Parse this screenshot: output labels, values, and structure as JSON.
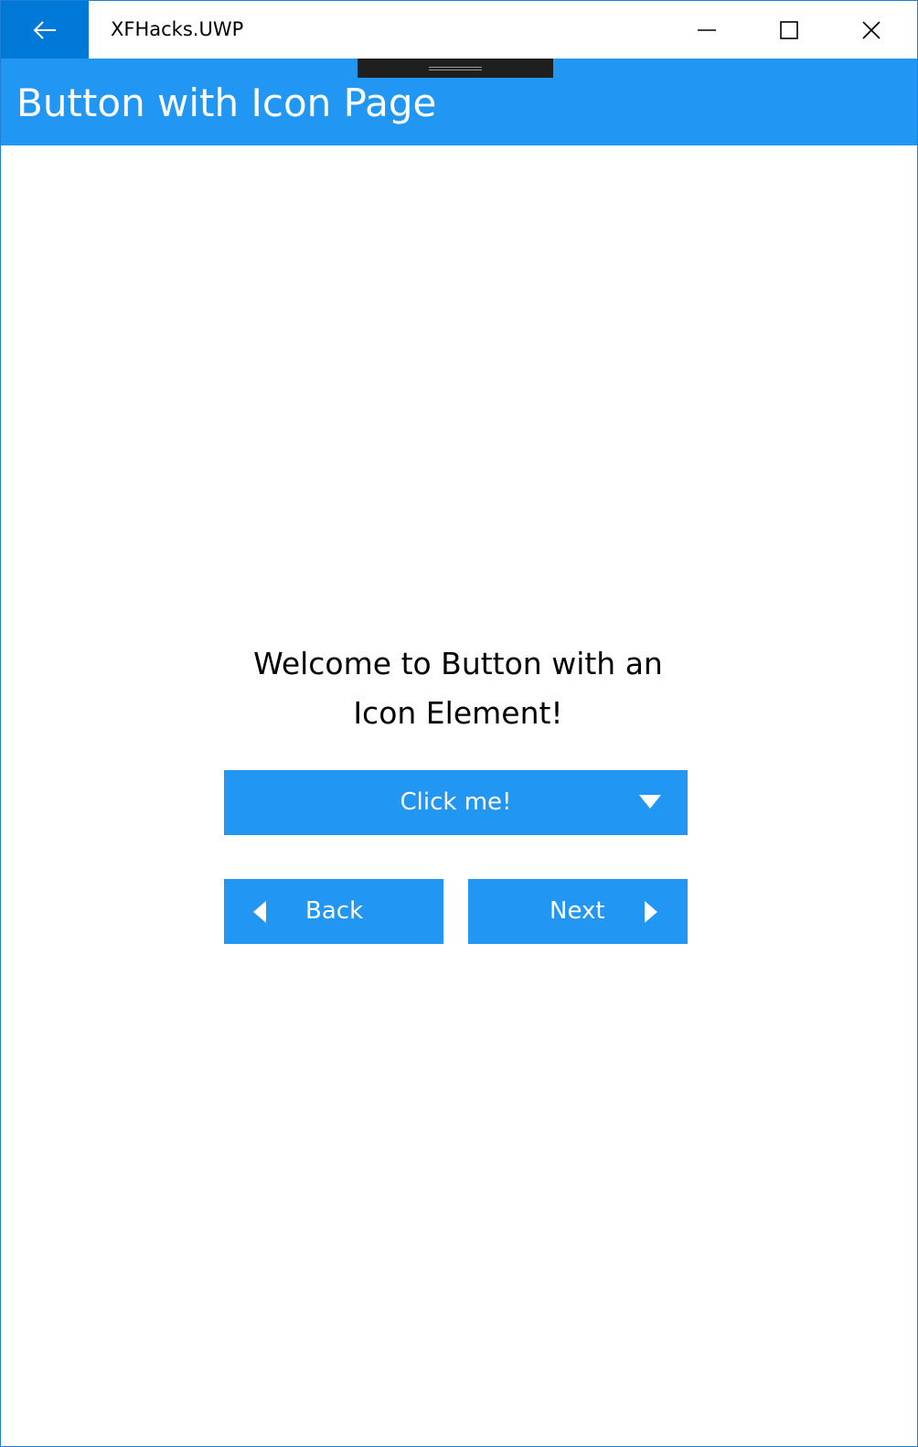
{
  "window": {
    "app_title": "XFHacks.UWP",
    "back_icon": "arrow-left-icon",
    "minimize_icon": "minimize-icon",
    "maximize_icon": "maximize-icon",
    "close_icon": "close-icon"
  },
  "header": {
    "title": "Button with Icon Page"
  },
  "main": {
    "welcome_line1": "Welcome to Button with an",
    "welcome_line2": "Icon Element!",
    "click_button": {
      "label": "Click me!",
      "icon": "caret-down-icon"
    },
    "back_button": {
      "label": "Back",
      "icon": "caret-left-icon"
    },
    "next_button": {
      "label": "Next",
      "icon": "caret-right-icon"
    }
  },
  "colors": {
    "accent": "#2196f3",
    "titlebar_back": "#0078d7",
    "window_border": "#1f7fd4"
  }
}
